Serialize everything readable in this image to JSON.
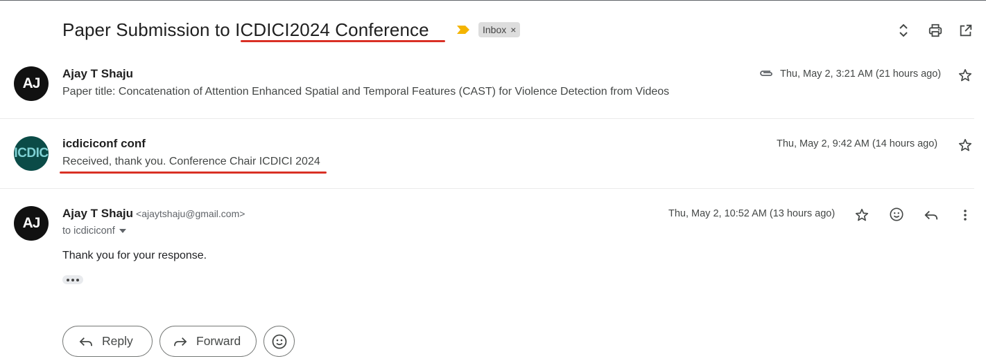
{
  "thread": {
    "subject": "Paper Submission to ICDICI2024 Conference",
    "label": "Inbox",
    "label_remove": "×"
  },
  "messages": [
    {
      "avatar_text": "AJ",
      "sender": "Ajay T Shaju",
      "snippet": "Paper title: Concatenation of Attention Enhanced Spatial and Temporal Features (CAST) for Violence Detection from Videos",
      "date": "Thu, May 2, 3:21 AM (21 hours ago)",
      "has_attachment": true
    },
    {
      "avatar_text": "ICDIC",
      "sender": "icdiciconf conf",
      "snippet": "Received, thank you. Conference Chair ICDICI 2024",
      "date": "Thu, May 2, 9:42 AM (14 hours ago)"
    },
    {
      "avatar_text": "AJ",
      "sender": "Ajay T Shaju",
      "sender_email": "<ajaytshaju@gmail.com>",
      "recipient": "to icdiciconf",
      "date": "Thu, May 2, 10:52 AM (13 hours ago)",
      "body": "Thank you for your response."
    }
  ],
  "actions": {
    "reply": "Reply",
    "forward": "Forward"
  },
  "colors": {
    "annotation_red": "#d93025",
    "important_yellow": "#f4b400",
    "chip_bg": "#dddddd"
  },
  "icons": [
    "expand-collapse-icon",
    "print-icon",
    "open-new-window-icon",
    "attachment-icon",
    "star-icon",
    "emoji-icon",
    "reply-icon",
    "more-vert-icon",
    "forward-icon",
    "dropdown-icon"
  ]
}
